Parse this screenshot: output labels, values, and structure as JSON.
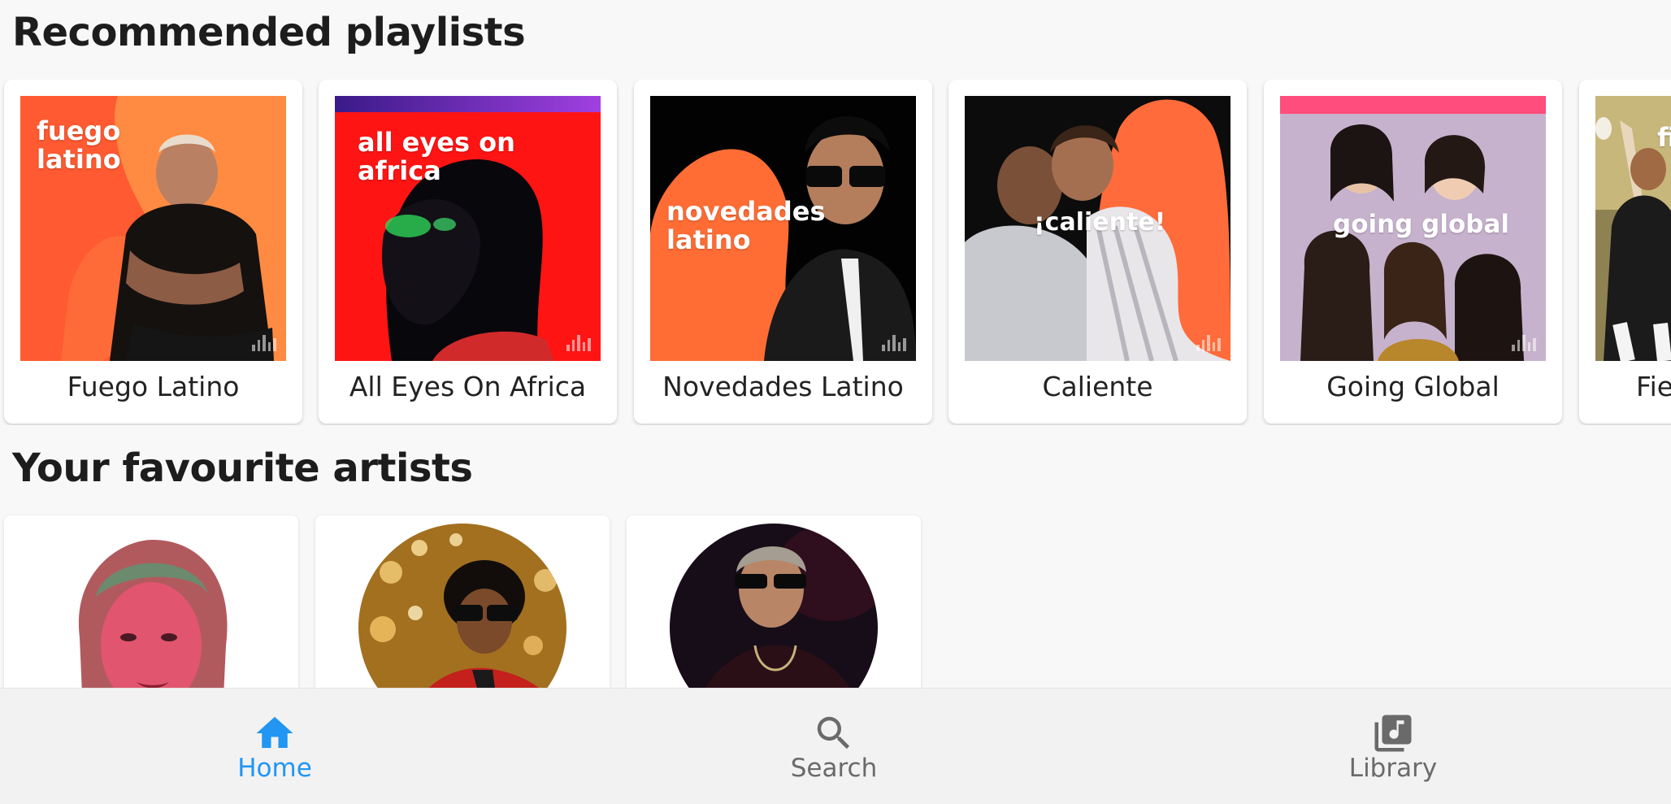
{
  "sections": {
    "playlists_title": "Recommended playlists",
    "artists_title": "Your favourite artists"
  },
  "playlists": [
    {
      "name": "Fuego Latino",
      "cover_text": "fuego\nlatino",
      "colors": [
        "#ff5b33",
        "#ffa64d"
      ]
    },
    {
      "name": "All Eyes On Africa",
      "cover_text": "all eyes on africa",
      "colors": [
        "#ff1a1a",
        "#6a2cd6"
      ]
    },
    {
      "name": "Novedades Latino",
      "cover_text": "novedades\nlatino",
      "colors": [
        "#000000",
        "#ff7a3d"
      ]
    },
    {
      "name": "Caliente",
      "cover_text": "¡caliente!",
      "colors": [
        "#111111",
        "#ff6a3d"
      ]
    },
    {
      "name": "Going Global",
      "cover_text": "going global",
      "colors": [
        "#c9b3cf",
        "#ff4f7a"
      ]
    },
    {
      "name": "Fie",
      "cover_text": "fi",
      "colors": [
        "#8a7a4a",
        "#d9c98f"
      ]
    }
  ],
  "artists": [
    {
      "avatar_colors": [
        "#ffffff",
        "#e0436b"
      ]
    },
    {
      "avatar_colors": [
        "#b8862b",
        "#d4261f"
      ]
    },
    {
      "avatar_colors": [
        "#0e0a14",
        "#5a1f2e"
      ]
    }
  ],
  "nav": {
    "items": [
      {
        "label": "Home",
        "icon": "home-icon",
        "active": true
      },
      {
        "label": "Search",
        "icon": "search-icon",
        "active": false
      },
      {
        "label": "Library",
        "icon": "library-music-icon",
        "active": false
      }
    ],
    "active_color": "#2196f3",
    "inactive_color": "#6a6a6a"
  }
}
